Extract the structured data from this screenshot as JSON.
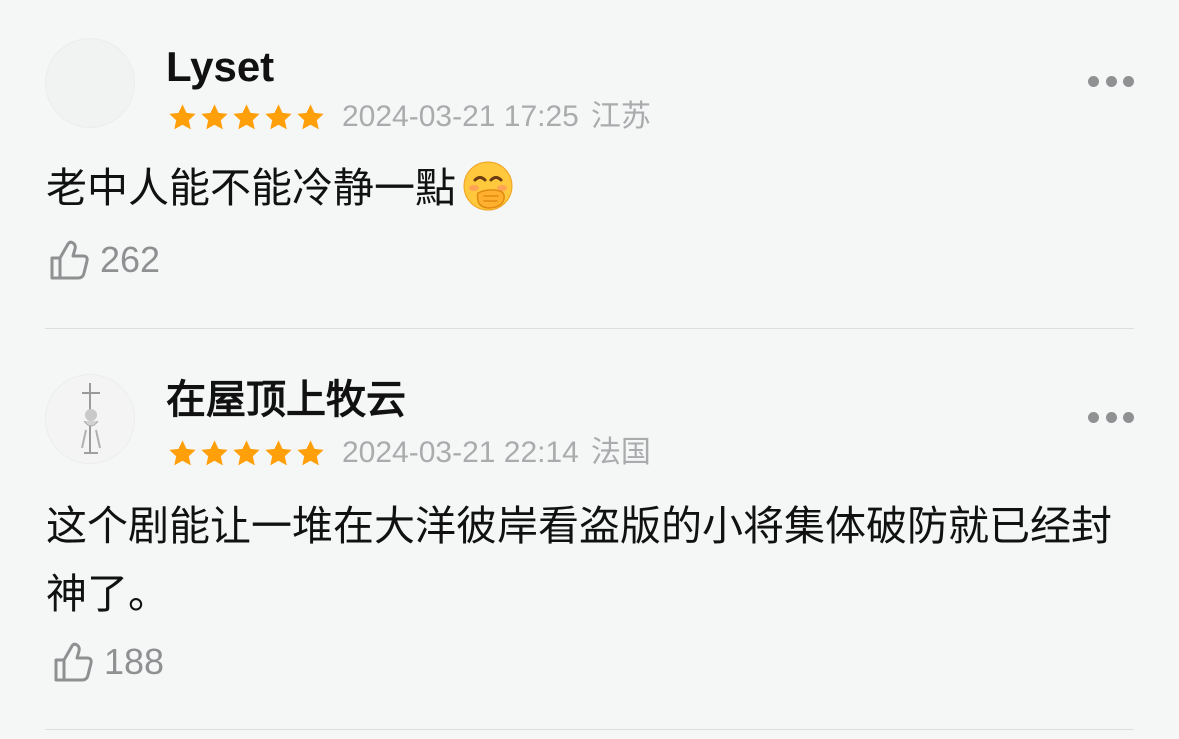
{
  "comments": [
    {
      "username": "Lyset",
      "rating": 5,
      "timestamp": "2024-03-21 17:25",
      "location": "江苏",
      "text": "老中人能不能冷静一點",
      "emoji": "face-with-hand-over-mouth",
      "likes": "262"
    },
    {
      "username": "在屋顶上牧云",
      "rating": 5,
      "timestamp": "2024-03-21 22:14",
      "location": "法国",
      "text": "这个剧能让一堆在大洋彼岸看盗版的小将集体破防就已经封神了。",
      "likes": "188"
    }
  ],
  "colors": {
    "star": "#ff9f0a",
    "meta_text": "#a9abad",
    "like_text": "#8e9092",
    "background": "#f5f7f7",
    "divider": "#dcdfe0"
  },
  "icons": {
    "more": "more-dots-icon",
    "like": "thumbs-up-icon",
    "star": "star-icon"
  }
}
